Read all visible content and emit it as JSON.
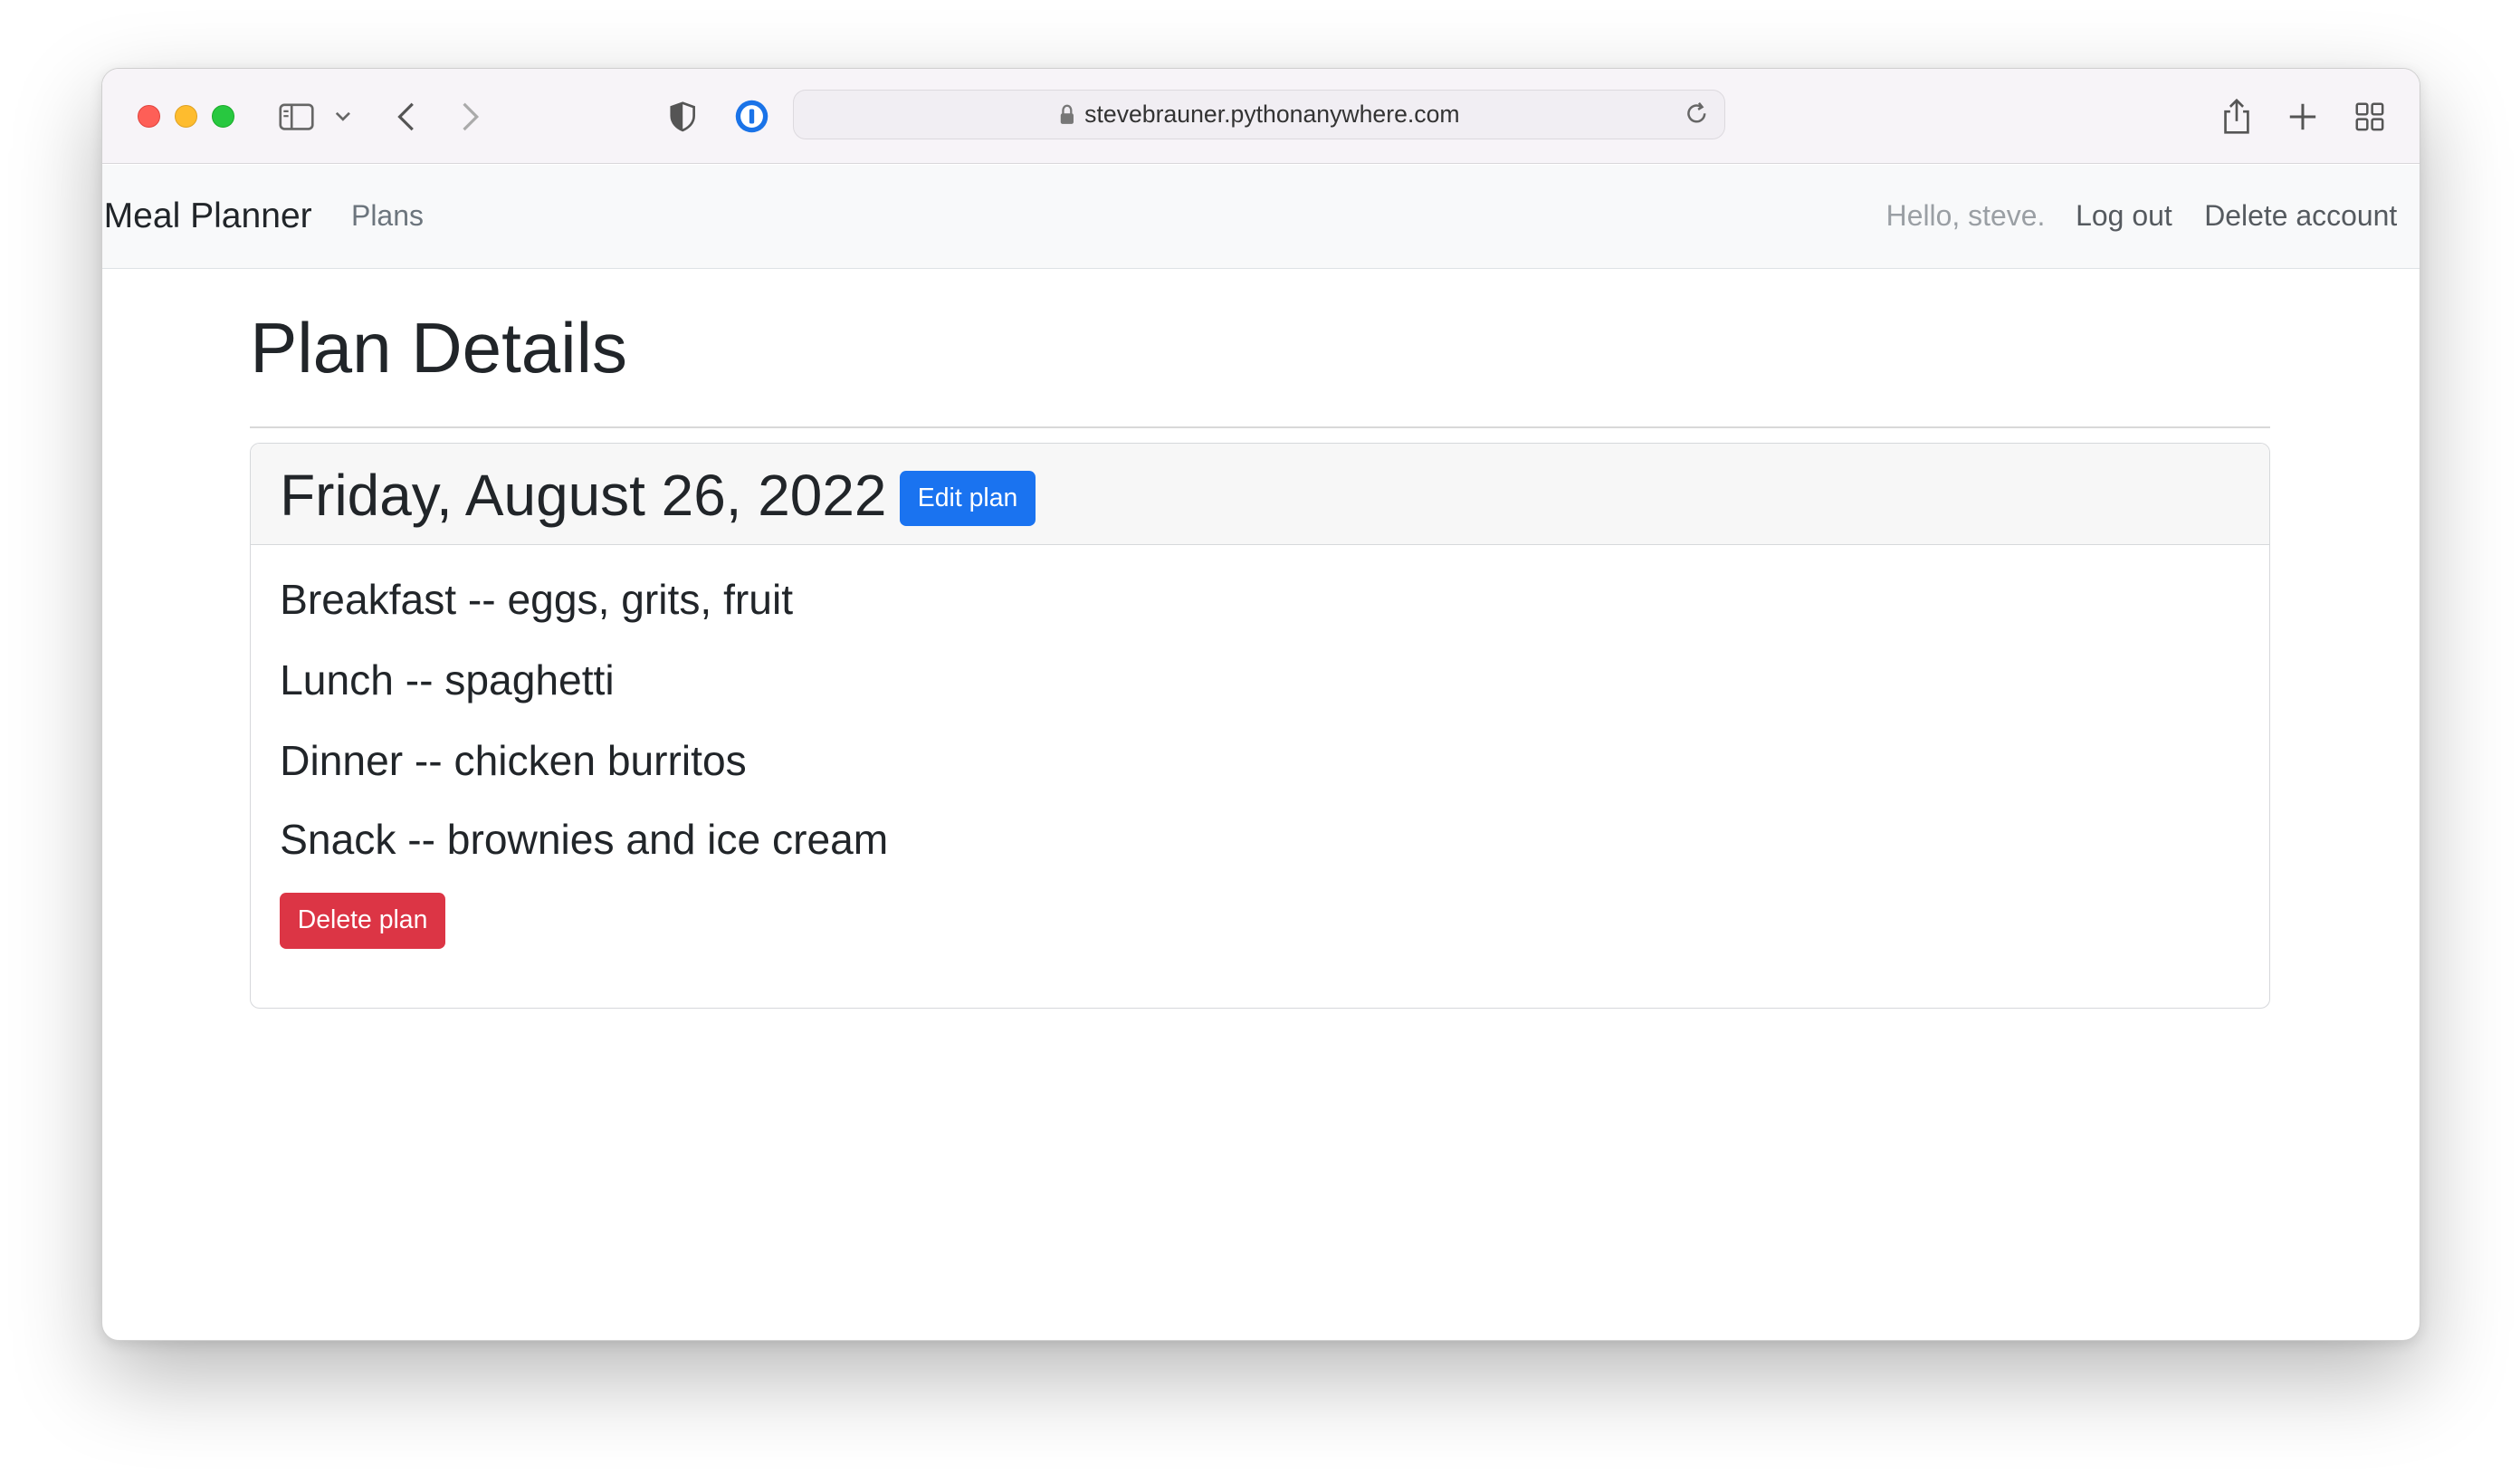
{
  "browser": {
    "url": "stevebrauner.pythonanywhere.com"
  },
  "navbar": {
    "brand": "Meal Planner",
    "plans_link": "Plans",
    "greeting": "Hello, steve.",
    "logout_link": "Log out",
    "delete_account_link": "Delete account"
  },
  "page": {
    "title": "Plan Details"
  },
  "plan": {
    "date": "Friday, August 26, 2022",
    "edit_label": "Edit plan",
    "meals": [
      "Breakfast -- eggs, grits, fruit",
      "Lunch -- spaghetti",
      "Dinner -- chicken burritos",
      "Snack -- brownies and ice cream"
    ],
    "delete_label": "Delete plan"
  },
  "colors": {
    "primary": "#1a73f0",
    "danger": "#dc3545",
    "traffic_red": "#fe5f57",
    "traffic_yellow": "#febc2e",
    "traffic_green": "#28c840"
  },
  "icons": {
    "toolbar": [
      "sidebar-icon",
      "chevron-down-icon",
      "back-arrow-icon",
      "forward-arrow-icon",
      "privacy-shield-icon",
      "password-manager-icon",
      "lock-icon",
      "reload-icon",
      "share-icon",
      "new-tab-plus-icon",
      "tab-overview-icon"
    ]
  }
}
